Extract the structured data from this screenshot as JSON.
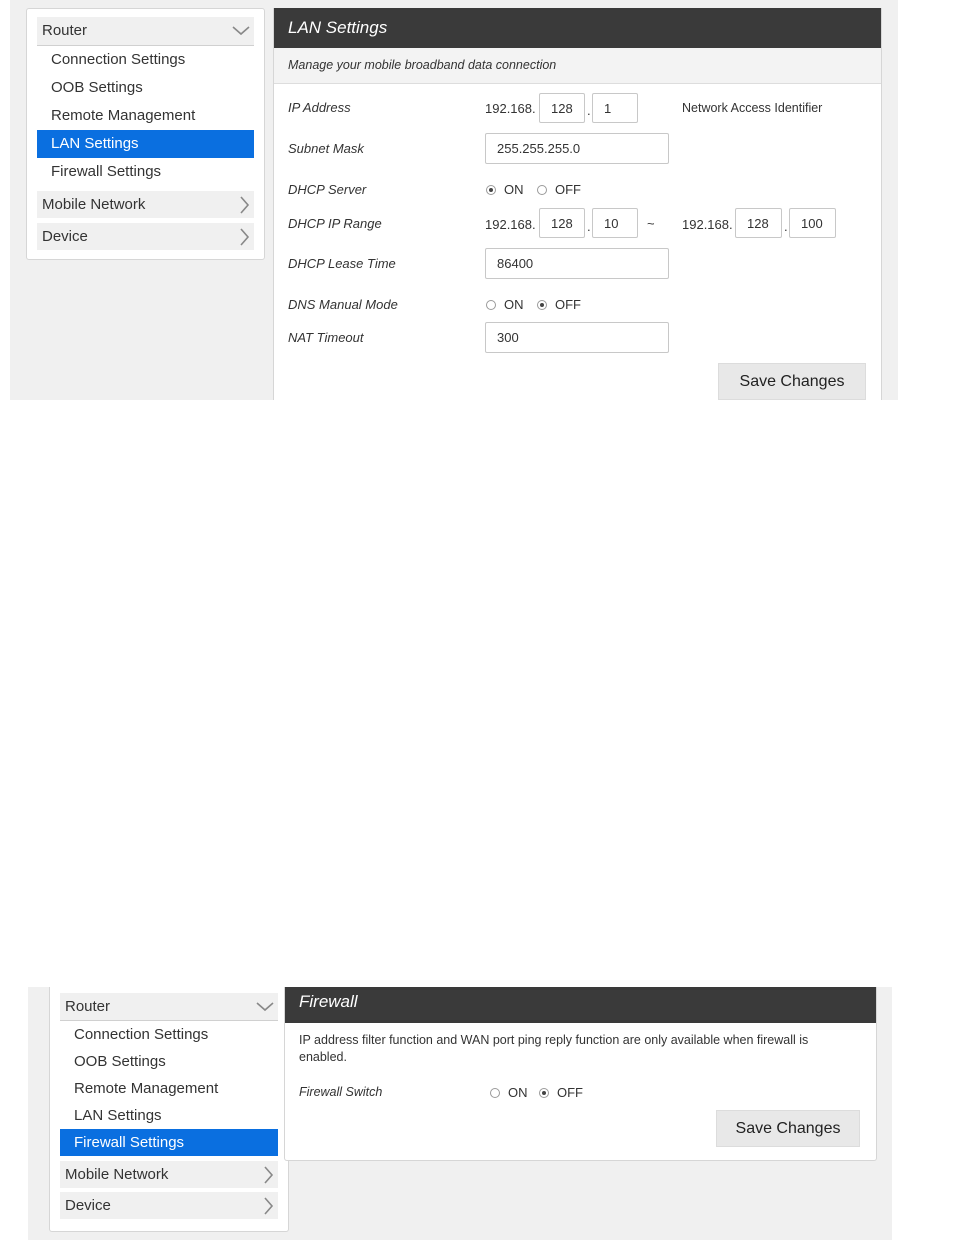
{
  "top": {
    "sidebar": {
      "router_label": "Router",
      "items": [
        "Connection Settings",
        "OOB Settings",
        "Remote Management",
        "LAN Settings",
        "Firewall Settings"
      ],
      "active_item": "LAN Settings",
      "mobile_network_label": "Mobile Network",
      "device_label": "Device"
    },
    "panel": {
      "title": "LAN Settings",
      "description": "Manage your mobile broadband data connection",
      "ip_address": {
        "label": "IP Address",
        "prefix": "192.168.",
        "octet3": "128",
        "octet4": "1",
        "note": "Network Access Identifier"
      },
      "subnet_mask": {
        "label": "Subnet Mask",
        "value": "255.255.255.0"
      },
      "dhcp_server": {
        "label": "DHCP Server",
        "on_label": "ON",
        "off_label": "OFF",
        "selected": "ON"
      },
      "dhcp_ip_range": {
        "label": "DHCP IP Range",
        "start_prefix": "192.168.",
        "start_octet3": "128",
        "start_octet4": "10",
        "separator": "~",
        "end_prefix": "192.168.",
        "end_octet3": "128",
        "end_octet4": "100"
      },
      "dhcp_lease_time": {
        "label": "DHCP Lease Time",
        "value": "86400"
      },
      "dns_manual_mode": {
        "label": "DNS Manual Mode",
        "on_label": "ON",
        "off_label": "OFF",
        "selected": "OFF"
      },
      "nat_timeout": {
        "label": "NAT Timeout",
        "value": "300"
      },
      "save_label": "Save Changes",
      "dot": "."
    }
  },
  "bottom": {
    "sidebar": {
      "router_label": "Router",
      "items": [
        "Connection Settings",
        "OOB Settings",
        "Remote Management",
        "LAN Settings",
        "Firewall Settings"
      ],
      "active_item": "Firewall Settings",
      "mobile_network_label": "Mobile Network",
      "device_label": "Device"
    },
    "panel": {
      "title": "Firewall",
      "description": "IP address filter function and WAN port ping reply function are only available when firewall is enabled.",
      "firewall_switch": {
        "label": "Firewall Switch",
        "on_label": "ON",
        "off_label": "OFF",
        "selected": "OFF"
      },
      "save_label": "Save Changes"
    }
  },
  "colors": {
    "active": "#0a6fe0",
    "title_bar": "#3a3a3a"
  },
  "icons": {
    "expanded": "chevron-down-icon",
    "collapsed": "chevron-right-icon"
  }
}
